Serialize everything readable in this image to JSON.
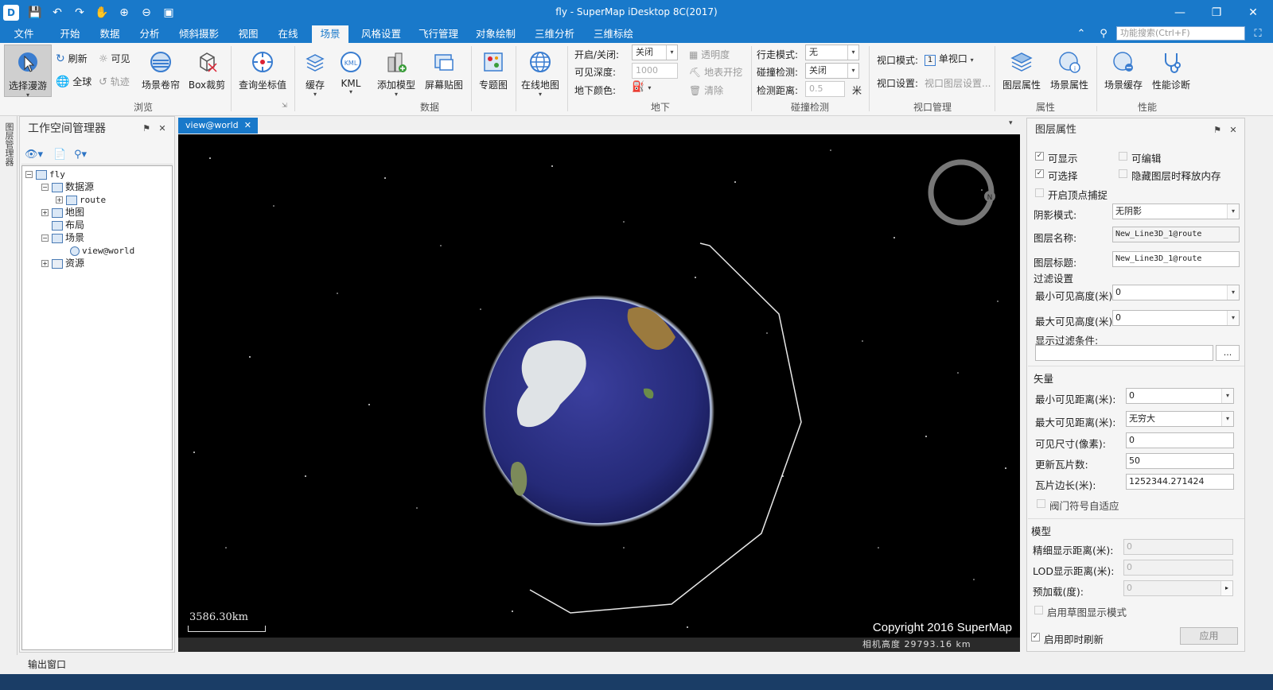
{
  "window": {
    "title": "fly - SuperMap iDesktop 8C(2017)",
    "minimize": "—",
    "maximize": "❐",
    "close": "✕"
  },
  "quick_access": [
    "save-icon",
    "undo-icon",
    "redo-icon",
    "pan-icon",
    "zoom-in-icon",
    "zoom-out-icon",
    "full-extent-icon"
  ],
  "menu": {
    "tabs": [
      "文件",
      "开始",
      "数据",
      "分析",
      "倾斜摄影",
      "视图",
      "在线",
      "场景",
      "风格设置",
      "飞行管理",
      "对象绘制",
      "三维分析",
      "三维标绘"
    ],
    "active": "场景",
    "search_placeholder": "功能搜索(Ctrl+F)"
  },
  "ribbon": {
    "browse": {
      "label": "浏览",
      "select_roam": "选择漫游",
      "refresh": "刷新",
      "visible": "可见",
      "globe": "全球",
      "track": "轨迹",
      "scene_roll": "场景卷帘",
      "box_clip": "Box裁剪",
      "query_coord": "查询坐标值"
    },
    "data": {
      "label": "数据",
      "cache": "缓存",
      "kml": "KML",
      "add_model": "添加模型",
      "screen_paste": "屏幕贴图",
      "thematic": "专题图",
      "online_map": "在线地图"
    },
    "underground": {
      "label": "地下",
      "onoff_label": "开启/关闭:",
      "onoff_value": "关闭",
      "depth_label": "可见深度:",
      "depth_value": "1000",
      "color_label": "地下颜色:",
      "transparency": "透明度",
      "surface_dig": "地表开挖",
      "clear": "清除"
    },
    "collision": {
      "label": "碰撞检测",
      "walk_label": "行走模式:",
      "walk_value": "无",
      "detect_label": "碰撞检测:",
      "detect_value": "关闭",
      "distance_label": "检测距离:",
      "distance_value": "0.5",
      "distance_unit": "米"
    },
    "viewport": {
      "label": "视口管理",
      "mode_label": "视口模式:",
      "mode_value": "单视口",
      "mode_num": "1",
      "settings_label": "视口设置:",
      "settings_value": "视口图层设置..."
    },
    "props": {
      "label": "属性",
      "layer_props": "图层属性",
      "scene_props": "场景属性"
    },
    "perf": {
      "label": "性能",
      "scene_cache": "场景缓存",
      "diagnose": "性能诊断"
    }
  },
  "left_strip": "图层管理器",
  "workspace": {
    "title": "工作空间管理器",
    "tree": {
      "root": "fly",
      "datasource": "数据源",
      "route": "route",
      "map": "地图",
      "layout": "布局",
      "scene": "场景",
      "view": "view@world",
      "resource": "资源"
    }
  },
  "document": {
    "tab": "view@world",
    "scale": "3586.30km",
    "copyright": "Copyright 2016 SuperMap",
    "camera_height": "相机高度 29793.16 km"
  },
  "layer_props": {
    "title": "图层属性",
    "visible": "可显示",
    "editable": "可编辑",
    "selectable": "可选择",
    "release_memory": "隐藏图层时释放内存",
    "vertex_snap": "开启顶点捕捉",
    "shadow_label": "阴影模式:",
    "shadow_value": "无阴影",
    "name_label": "图层名称:",
    "name_value": "New_Line3D_1@route",
    "caption_label": "图层标题:",
    "caption_value": "New_Line3D_1@route",
    "filter_section": "过滤设置",
    "min_height_label": "最小可见高度(米):",
    "min_height_value": "0",
    "max_height_label": "最大可见高度(米):",
    "max_height_value": "0",
    "filter_cond_label": "显示过滤条件:",
    "filter_cond_btn": "...",
    "vector_section": "矢量",
    "min_dist_label": "最小可见距离(米):",
    "min_dist_value": "0",
    "max_dist_label": "最大可见距离(米):",
    "max_dist_value": "无穷大",
    "size_label": "可见尺寸(像素):",
    "size_value": "0",
    "tiles_label": "更新瓦片数:",
    "tiles_value": "50",
    "tile_len_label": "瓦片边长(米):",
    "tile_len_value": "1252344.271424",
    "valve_adapt": "阀门符号自适应",
    "model_section": "模型",
    "detail_label": "精细显示距离(米):",
    "detail_value": "0",
    "lod_label": "LOD显示距离(米):",
    "lod_value": "0",
    "preload_label": "预加载(度):",
    "preload_value": "0",
    "sketch_mode": "启用草图显示模式",
    "instant_refresh": "启用即时刷新",
    "apply": "应用"
  },
  "output_window": "输出窗口",
  "colors": {
    "accent": "#1979ca",
    "viewport_bg": "#000000",
    "globe_ocean": "#2b2f8a",
    "route_line": "#e8e8e8"
  }
}
